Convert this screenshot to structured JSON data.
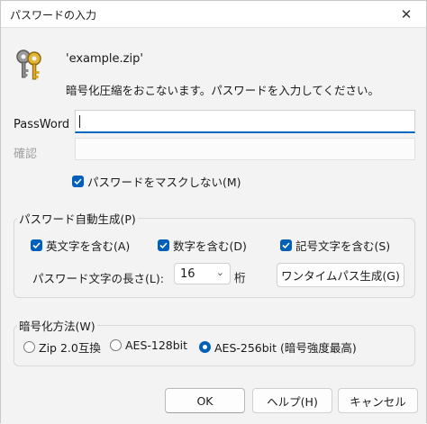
{
  "window": {
    "title": "パスワードの入力",
    "close_glyph": "✕"
  },
  "header": {
    "filename": "'example.zip'",
    "message": "暗号化圧縮をおこないます。パスワードを入力してください。"
  },
  "fields": {
    "password_label": "PassWord",
    "password_value": "",
    "confirm_label": "確認",
    "confirm_value": ""
  },
  "mask_option": {
    "label": "パスワードをマスクしない(M)",
    "checked": true
  },
  "autogen": {
    "title": "パスワード自動生成(P)",
    "options": [
      {
        "label": "英文字を含む(A)",
        "checked": true
      },
      {
        "label": "数字を含む(D)",
        "checked": true
      },
      {
        "label": "記号文字を含む(S)",
        "checked": true
      }
    ],
    "length_label": "パスワード文字の長さ(L):",
    "length_value": "16",
    "length_unit": "桁",
    "generate_button": "ワンタイムパス生成(G)"
  },
  "encryption": {
    "title": "暗号化方法(W)",
    "options": [
      {
        "label": "Zip 2.0互換",
        "selected": false
      },
      {
        "label": "AES-128bit",
        "selected": false
      },
      {
        "label": "AES-256bit (暗号強度最高)",
        "selected": true
      }
    ]
  },
  "buttons": {
    "ok": "OK",
    "help": "ヘルプ(H)",
    "cancel": "キャンセル"
  },
  "colors": {
    "accent": "#005fb8",
    "focus_underline": "#0067c0"
  }
}
